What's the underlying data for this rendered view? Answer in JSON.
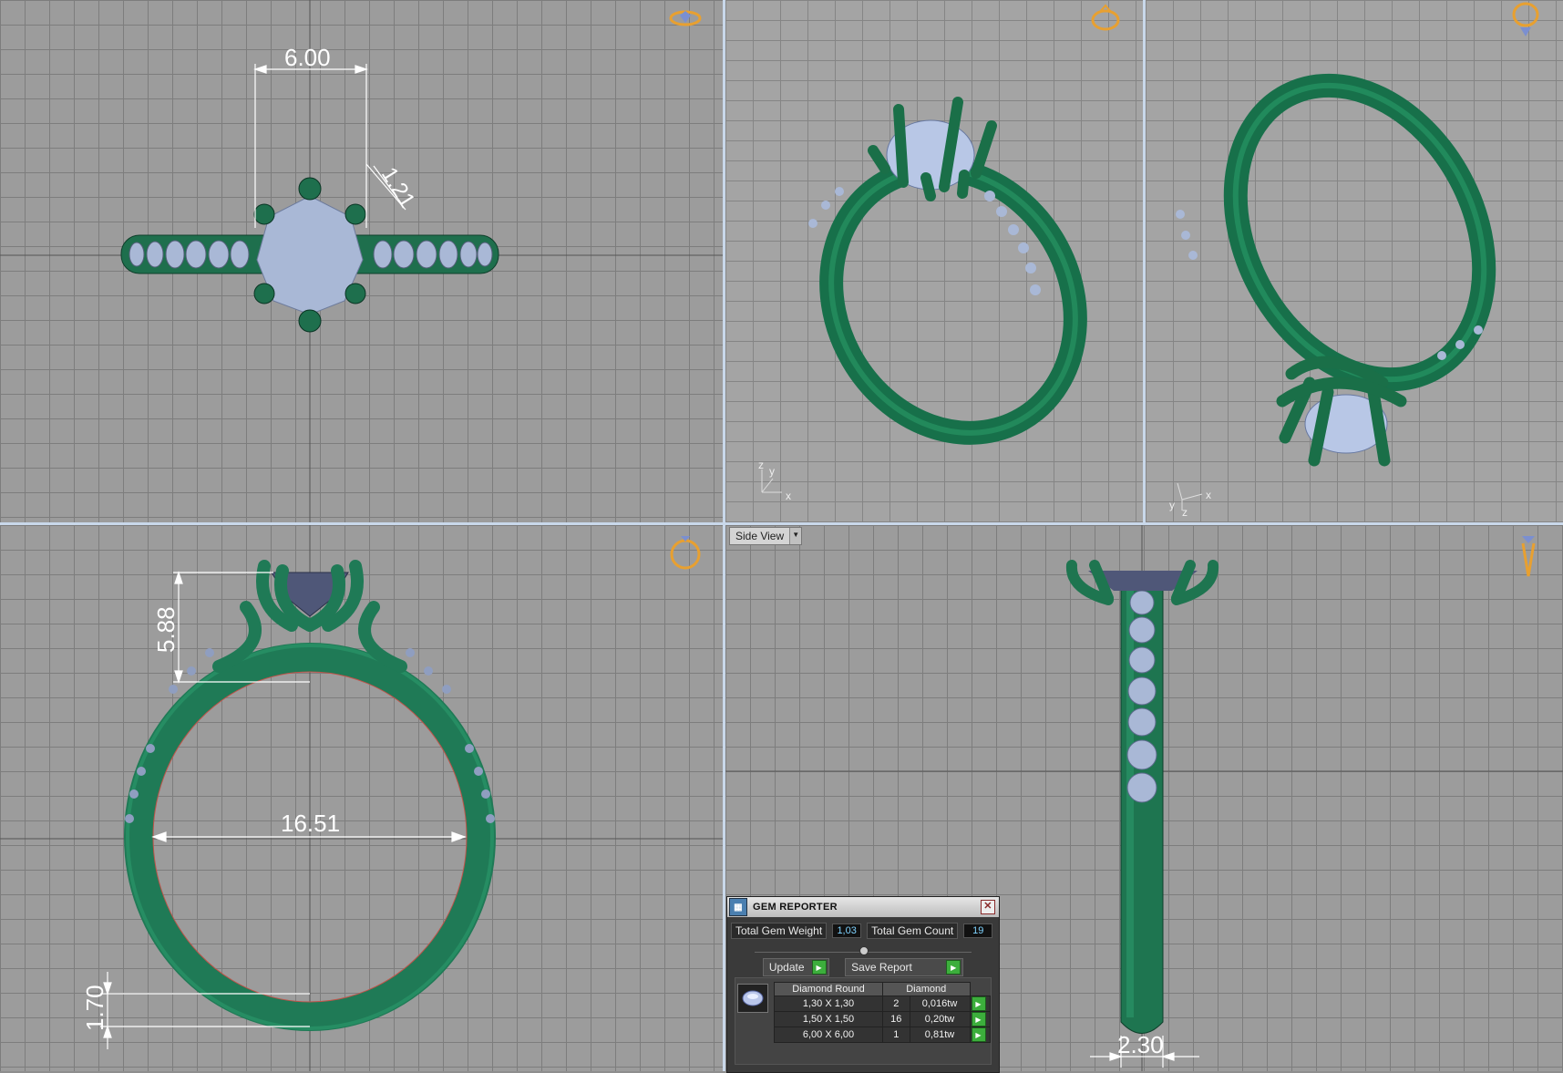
{
  "viewports": {
    "top": {
      "dim_width": "6.00",
      "dim_prong": "1.21",
      "view_icon": "top-view-icon"
    },
    "perspective": {
      "axis_x": "x",
      "axis_y": "y",
      "axis_z": "z",
      "view_icon": "perspective-view-icon"
    },
    "perspective_back": {
      "axis_x": "x",
      "axis_y": "y",
      "axis_z": "z",
      "view_icon": "bottom-view-icon"
    },
    "front": {
      "dim_head_height": "5.88",
      "dim_inner_diameter": "16.51",
      "dim_band_thickness": "1.70",
      "view_icon": "front-view-icon"
    },
    "side": {
      "dropdown_label": "Side View",
      "dim_band_width": "2.30",
      "view_icon": "side-view-icon"
    }
  },
  "gem_reporter": {
    "title": "GEM REPORTER",
    "total_weight_label": "Total Gem Weight",
    "total_weight_value": "1,03",
    "total_count_label": "Total Gem Count",
    "total_count_value": "19",
    "update_label": "Update",
    "save_report_label": "Save Report",
    "table_headers": [
      "Diamond Round",
      "Diamond"
    ],
    "rows": [
      {
        "size": "1,30 X 1,30",
        "count": "2",
        "weight": "0,016tw"
      },
      {
        "size": "1,50 X 1,50",
        "count": "16",
        "weight": "0,20tw"
      },
      {
        "size": "6,00 X 6,00",
        "count": "1",
        "weight": "0,81tw"
      }
    ]
  },
  "colors": {
    "metal": "#1e7a54",
    "metal_dark": "#0f4a33",
    "gem": "#a9b8d6",
    "gem_dark": "#7789ad",
    "dimension": "#ffffff",
    "accent": "#e8a030"
  }
}
